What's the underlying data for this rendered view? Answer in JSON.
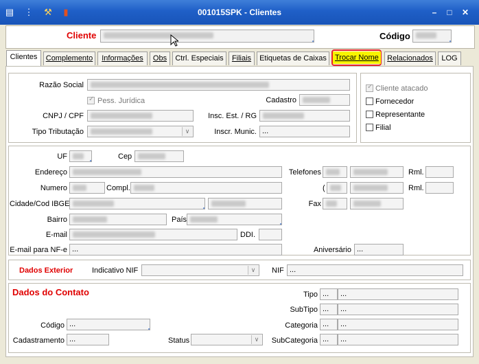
{
  "window": {
    "title": "001015SPK - Clientes"
  },
  "toolbar": {
    "icons": [
      "list-icon",
      "traffic-light-icon",
      "wrench-icon",
      "book-icon"
    ]
  },
  "header": {
    "cliente_label": "Cliente",
    "codigo_label": "Código"
  },
  "tabs": [
    {
      "label": "Clientes",
      "active": true
    },
    {
      "label": "Complemento"
    },
    {
      "label": "Informações"
    },
    {
      "label": "Obs"
    },
    {
      "label": "Ctrl. Especiais"
    },
    {
      "label": "Filiais"
    },
    {
      "label": "Etiquetas de Caixas"
    },
    {
      "label": "Trocar Nome",
      "highlight": true
    },
    {
      "label": "Relacionados"
    },
    {
      "label": "LOG"
    }
  ],
  "general": {
    "razao_social": "Razão Social",
    "pess_juridica": "Pess. Jurídica",
    "cadastro": "Cadastro",
    "cnpj": "CNPJ / CPF",
    "insc_est": "Insc. Est. / RG",
    "tipo_trib": "Tipo Tributação",
    "insc_munic": "Inscr. Munic.",
    "insc_munic_value": "..."
  },
  "types": {
    "cliente_atacado": "Cliente atacado",
    "fornecedor": "Fornecedor",
    "representante": "Representante",
    "filial": "Filial"
  },
  "address": {
    "uf": "UF",
    "cep": "Cep",
    "endereco": "Endereço",
    "numero": "Numero",
    "compl": "Compl.",
    "cidade": "Cidade/Cod IBGE",
    "bairro": "Bairro",
    "pais": "País",
    "email": "E-mail",
    "ddi": "DDI.",
    "email_nfe": "E-mail para NF-e",
    "email_nfe_value": "...",
    "telefones": "Telefones",
    "paren": "(",
    "rml1": "Rml.",
    "rml2": "Rml.",
    "fax": "Fax",
    "aniversario": "Aniversário",
    "aniversario_value": "..."
  },
  "exterior": {
    "title": "Dados Exterior",
    "indicativo_nif": "Indicativo NIF",
    "nif": "NIF",
    "nif_value": "..."
  },
  "contato": {
    "title": "Dados do Contato",
    "tipo": "Tipo",
    "subtipo": "SubTipo",
    "categoria": "Categoria",
    "subcategoria": "SubCategoria",
    "codigo": "Código",
    "cadastramento": "Cadastramento",
    "status": "Status",
    "ellipsis": "..."
  }
}
